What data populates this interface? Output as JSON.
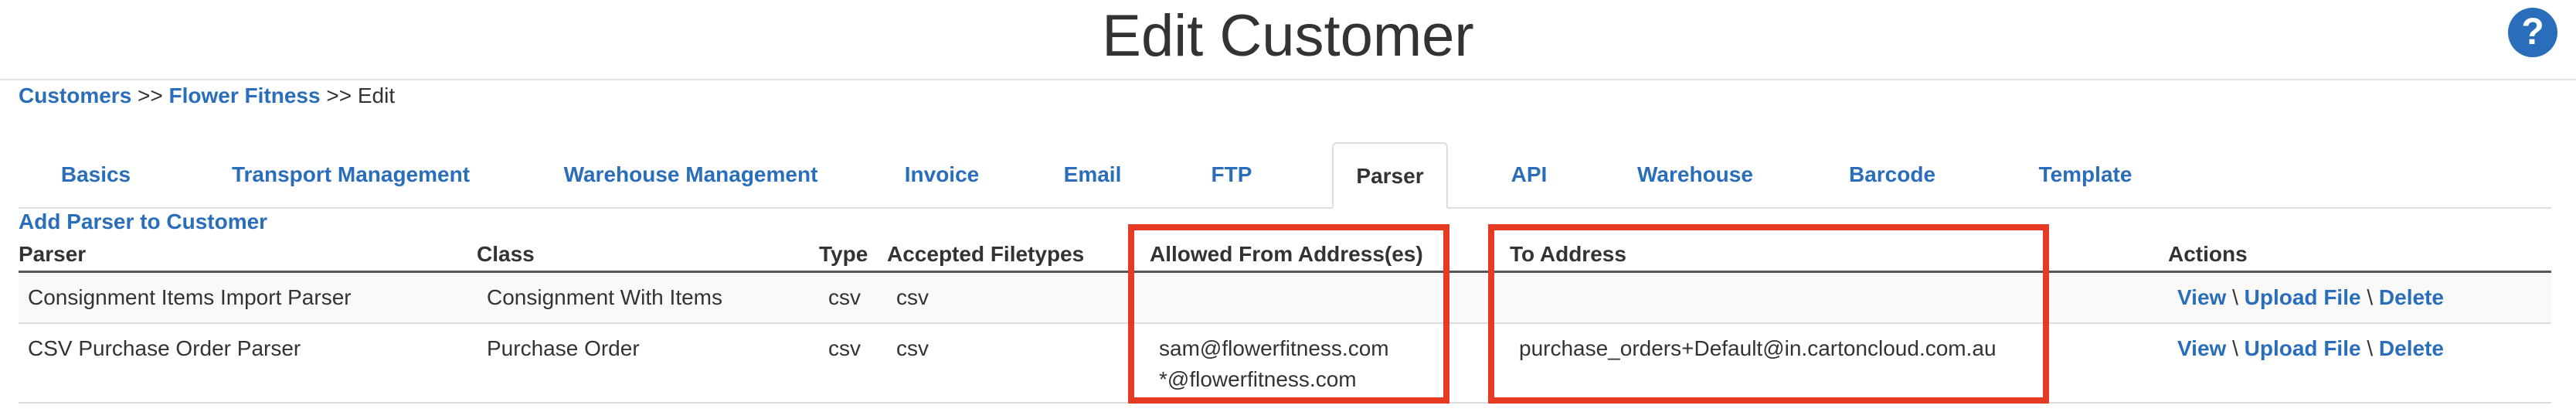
{
  "header": {
    "title": "Edit Customer",
    "help_icon": "?"
  },
  "breadcrumb": {
    "customers": "Customers",
    "sep1": ">>",
    "customer": "Flower Fitness",
    "sep2": ">>",
    "current": "Edit"
  },
  "tabs": [
    {
      "label": "Basics"
    },
    {
      "label": "Transport Management"
    },
    {
      "label": "Warehouse Management"
    },
    {
      "label": "Invoice"
    },
    {
      "label": "Email"
    },
    {
      "label": "FTP"
    },
    {
      "label": "Parser",
      "active": true
    },
    {
      "label": "API"
    },
    {
      "label": "Warehouse"
    },
    {
      "label": "Barcode"
    },
    {
      "label": "Template"
    }
  ],
  "add_link": "Add Parser to Customer",
  "table": {
    "headers": {
      "parser": "Parser",
      "class": "Class",
      "type": "Type",
      "filetypes": "Accepted Filetypes",
      "allowed_from": "Allowed From Address(es)",
      "to_address": "To Address",
      "actions": "Actions"
    },
    "rows": [
      {
        "parser": "Consignment Items Import Parser",
        "class": "Consignment With Items",
        "type": "csv",
        "filetypes": "csv",
        "allowed_from_1": "",
        "allowed_from_2": "",
        "to_address": ""
      },
      {
        "parser": "CSV Purchase Order Parser",
        "class": "Purchase Order",
        "type": "csv",
        "filetypes": "csv",
        "allowed_from_1": "sam@flowerfitness.com",
        "allowed_from_2": "*@flowerfitness.com",
        "to_address": "purchase_orders+Default@in.cartoncloud.com.au"
      }
    ],
    "actions": {
      "view": "View",
      "upload": "Upload File",
      "delete": "Delete",
      "sep": "\\"
    }
  },
  "colors": {
    "link": "#2a6ebb",
    "highlight": "#e53a23",
    "text": "#333333"
  }
}
